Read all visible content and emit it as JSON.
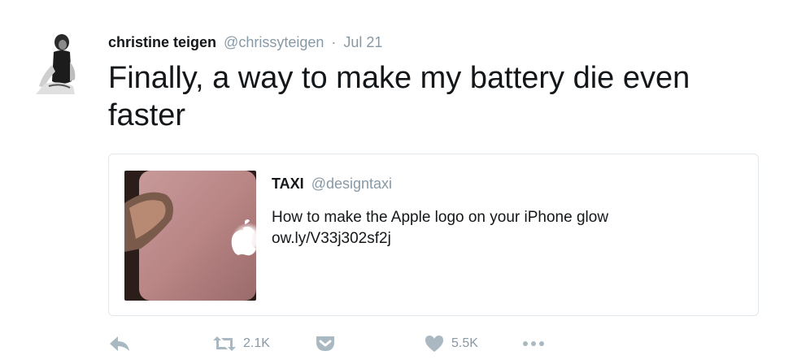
{
  "tweet": {
    "author_name": "christine teigen",
    "author_handle": "@chrissyteigen",
    "separator": "·",
    "date": "Jul 21",
    "text": "Finally, a way to make my battery die even faster"
  },
  "quoted": {
    "name": "TAXI",
    "handle": "@designtaxi",
    "text_line1": "How to make the Apple logo on your iPhone glow",
    "text_line2": "ow.ly/V33j302sf2j"
  },
  "actions": {
    "reply_icon": "reply-icon",
    "retweet_icon": "retweet-icon",
    "retweet_count": "2.1K",
    "pocket_icon": "pocket-icon",
    "like_icon": "heart-icon",
    "like_count": "5.5K",
    "more_icon": "more-icon"
  },
  "colors": {
    "text": "#14171a",
    "secondary": "#8899a6",
    "icon": "#aab8c2",
    "border": "#e1e8ed"
  }
}
